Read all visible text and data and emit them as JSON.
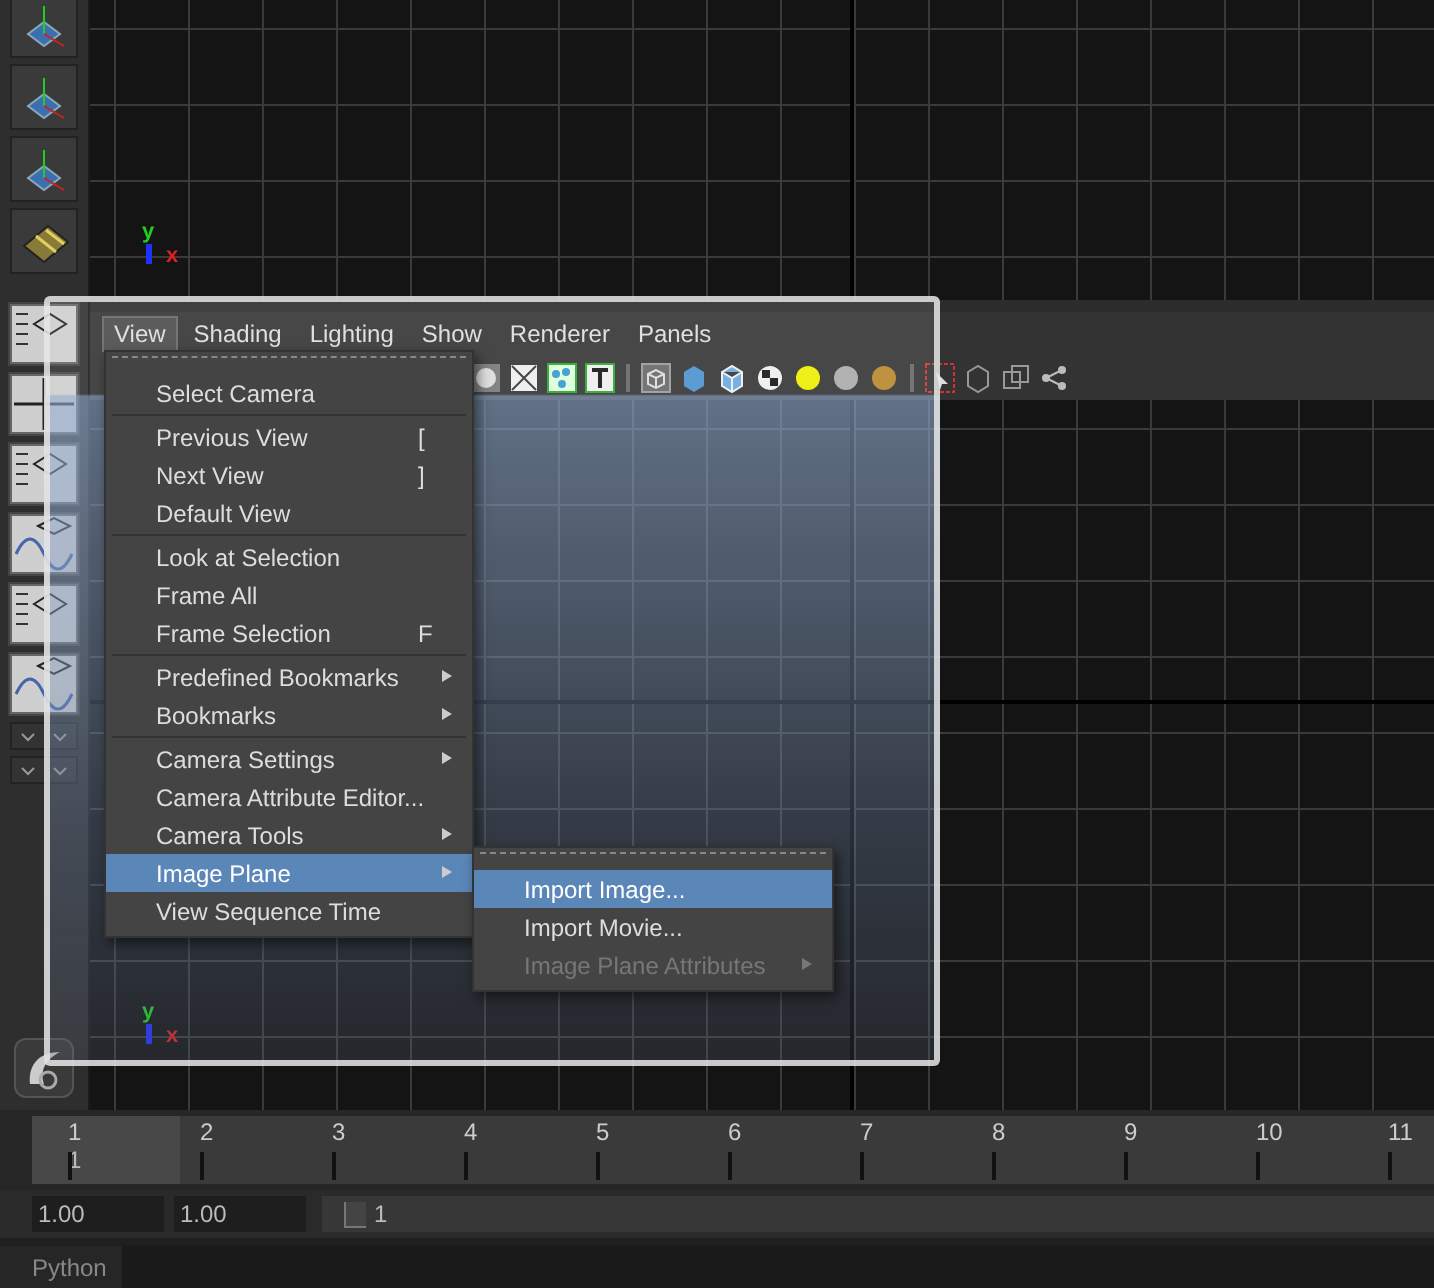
{
  "panel_menus": [
    {
      "label": "View",
      "selected": true
    },
    {
      "label": "Shading",
      "selected": false
    },
    {
      "label": "Lighting",
      "selected": false
    },
    {
      "label": "Show",
      "selected": false
    },
    {
      "label": "Renderer",
      "selected": false
    },
    {
      "label": "Panels",
      "selected": false
    }
  ],
  "view_menu": {
    "items": [
      {
        "kind": "item",
        "label": "Select Camera",
        "selected": false
      },
      {
        "kind": "separator"
      },
      {
        "kind": "item",
        "label": "Previous View",
        "shortcut": "[",
        "selected": false
      },
      {
        "kind": "item",
        "label": "Next View",
        "shortcut": "]",
        "selected": false
      },
      {
        "kind": "item",
        "label": "Default View",
        "selected": false
      },
      {
        "kind": "separator"
      },
      {
        "kind": "item",
        "label": "Look at Selection",
        "selected": false
      },
      {
        "kind": "item",
        "label": "Frame All",
        "selected": false
      },
      {
        "kind": "item",
        "label": "Frame Selection",
        "shortcut": "F",
        "selected": false
      },
      {
        "kind": "separator"
      },
      {
        "kind": "submenu",
        "label": "Predefined Bookmarks",
        "selected": false
      },
      {
        "kind": "submenu",
        "label": "Bookmarks",
        "selected": false
      },
      {
        "kind": "separator"
      },
      {
        "kind": "submenu",
        "label": "Camera Settings",
        "selected": false
      },
      {
        "kind": "item",
        "label": "Camera Attribute Editor...",
        "selected": false
      },
      {
        "kind": "submenu",
        "label": "Camera Tools",
        "selected": false
      },
      {
        "kind": "submenu",
        "label": "Image Plane",
        "selected": true
      },
      {
        "kind": "item",
        "label": "View Sequence Time",
        "selected": false
      }
    ]
  },
  "image_plane_submenu": {
    "items": [
      {
        "kind": "item",
        "label": "Import Image...",
        "selected": true,
        "disabled": false
      },
      {
        "kind": "item",
        "label": "Import Movie...",
        "selected": false,
        "disabled": false
      },
      {
        "kind": "submenu",
        "label": "Image Plane Attributes",
        "selected": false,
        "disabled": true
      }
    ]
  },
  "axis_labels": {
    "top": [
      "y",
      "x"
    ],
    "bottom": [
      "y",
      "x"
    ]
  },
  "time_slider": {
    "frames": [
      "1",
      "2",
      "3",
      "4",
      "5",
      "6",
      "7",
      "8",
      "9",
      "10",
      "11"
    ],
    "current_frame": "1",
    "level": 0.1
  },
  "range_slider": {
    "start": "1.00",
    "end": "1.00",
    "range_start": "1",
    "level": 1
  },
  "command_line": {
    "tab": "Python"
  }
}
